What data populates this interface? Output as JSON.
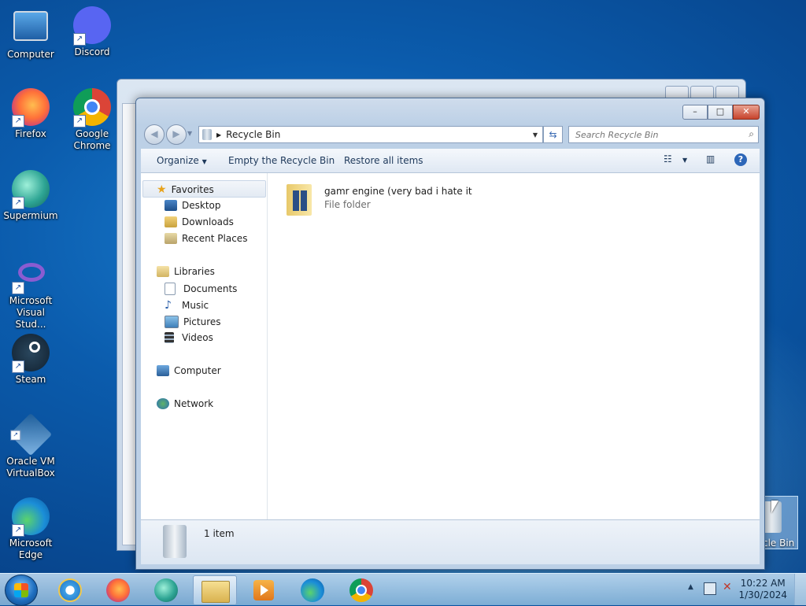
{
  "desktop": {
    "icons": [
      {
        "label": "Computer"
      },
      {
        "label": "Discord"
      },
      {
        "label": "Firefox"
      },
      {
        "label": "Google Chrome"
      },
      {
        "label": "Supermium"
      },
      {
        "label": "Microsoft Visual Stud..."
      },
      {
        "label": "Steam"
      },
      {
        "label": "Oracle VM VirtualBox"
      },
      {
        "label": "Microsoft Edge"
      }
    ],
    "recycle_bin_label": "cle Bin"
  },
  "window": {
    "title_buttons": {
      "min": "–",
      "max": "□",
      "close": "✕"
    },
    "address": "Recycle Bin",
    "search_placeholder": "Search Recycle Bin",
    "commands": {
      "organize": "Organize",
      "empty": "Empty the Recycle Bin",
      "restore": "Restore all items"
    },
    "nav": {
      "favorites": "Favorites",
      "fav_items": [
        "Desktop",
        "Downloads",
        "Recent Places"
      ],
      "libraries": "Libraries",
      "lib_items": [
        "Documents",
        "Music",
        "Pictures",
        "Videos"
      ],
      "computer": "Computer",
      "network": "Network"
    },
    "items": [
      {
        "name": "gamr engine (very bad i hate it",
        "type": "File folder"
      }
    ],
    "details": {
      "count": "1 item"
    }
  },
  "taskbar": {
    "clock_time": "10:22 AM",
    "clock_date": "1/30/2024",
    "apps": [
      "Internet Explorer",
      "Firefox",
      "Supermium",
      "Windows Explorer",
      "Media Player",
      "Microsoft Edge",
      "Google Chrome"
    ]
  },
  "colors": {
    "accent": "#3b6bb3",
    "close_button": "#c7432c",
    "desktop_blue": "#0b5cad"
  }
}
